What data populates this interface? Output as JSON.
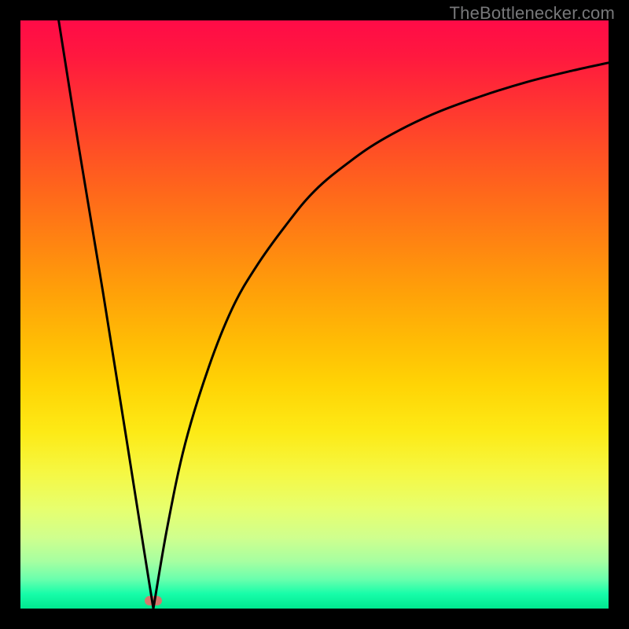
{
  "watermark": "TheBottlenecker.com",
  "gradient_colors": {
    "top": "#ff0b47",
    "mid": "#ffd405",
    "bottom": "#00e88f"
  },
  "dot": {
    "x_pct": 22.6,
    "y_pct": 98.7,
    "color": "#d5776c"
  },
  "chart_data": {
    "type": "line",
    "title": "",
    "xlabel": "",
    "ylabel": "",
    "xlim": [
      0,
      100
    ],
    "ylim": [
      0,
      100
    ],
    "legend": false,
    "grid": false,
    "annotations": [],
    "series": [
      {
        "name": "left-branch",
        "x": [
          6.5,
          10,
          14,
          18,
          21,
          22.6
        ],
        "values": [
          100,
          78,
          54,
          29,
          10,
          0
        ]
      },
      {
        "name": "right-branch",
        "x": [
          22.6,
          25,
          28,
          32,
          36,
          40,
          45,
          50,
          56,
          62,
          70,
          78,
          86,
          94,
          100
        ],
        "values": [
          0,
          14,
          28,
          41,
          51,
          58,
          65,
          71,
          76,
          80,
          84,
          87,
          89.5,
          91.5,
          92.8
        ]
      }
    ],
    "marker": {
      "x": 22.6,
      "y": 0
    }
  }
}
